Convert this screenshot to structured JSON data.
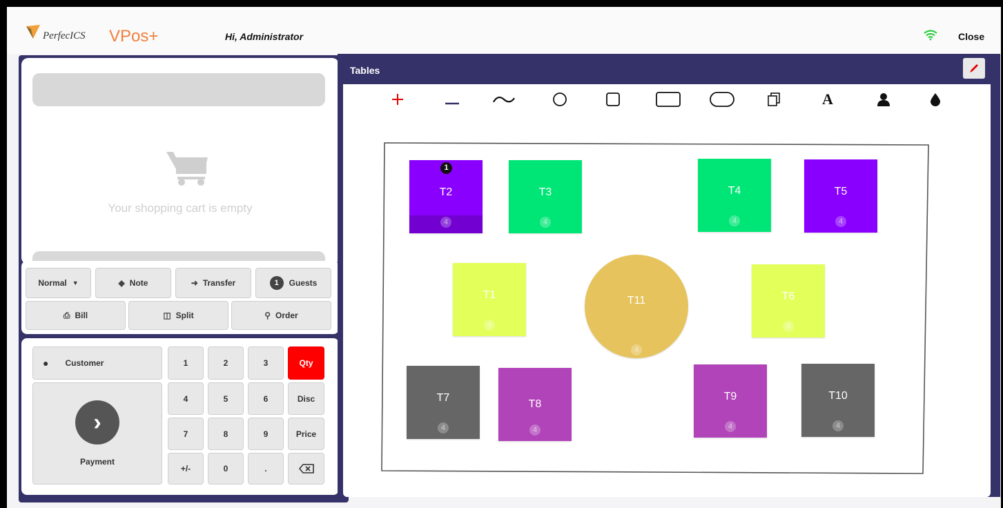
{
  "header": {
    "brand_perfecics": "PerfecICS",
    "brand_vpos": "VPos+",
    "greeting": "Hi, Administrator",
    "close_label": "Close"
  },
  "cart": {
    "empty_text": "Your shopping cart is empty"
  },
  "actions": {
    "mode": "Normal",
    "note": "Note",
    "transfer": "Transfer",
    "guests_count": "1",
    "guests": "Guests",
    "bill": "Bill",
    "split": "Split",
    "order": "Order"
  },
  "keypad": {
    "customer": "Customer",
    "payment": "Payment",
    "keys": [
      "1",
      "2",
      "3",
      "Qty",
      "4",
      "5",
      "6",
      "Disc",
      "7",
      "8",
      "9",
      "Price",
      "+/-",
      "0",
      "."
    ]
  },
  "tables": {
    "title": "Tables",
    "tools": [
      "add-icon",
      "remove-icon",
      "freehand-icon",
      "circle-icon",
      "square-icon",
      "rectangle-icon",
      "rounded-rect-icon",
      "copy-icon",
      "text-icon",
      "person-icon",
      "color-drop-icon"
    ],
    "items": [
      {
        "name": "T2",
        "seats": "4",
        "color": "#8a00ff",
        "badge": "1"
      },
      {
        "name": "T3",
        "seats": "4",
        "color": "#00e676"
      },
      {
        "name": "T4",
        "seats": "4",
        "color": "#00e676"
      },
      {
        "name": "T5",
        "seats": "4",
        "color": "#8a00ff"
      },
      {
        "name": "T1",
        "seats": "4",
        "color": "#e2ff5a"
      },
      {
        "name": "T11",
        "seats": "4",
        "color": "#e6c35c"
      },
      {
        "name": "T6",
        "seats": "4",
        "color": "#e2ff5a"
      },
      {
        "name": "T7",
        "seats": "4",
        "color": "#666666"
      },
      {
        "name": "T8",
        "seats": "4",
        "color": "#b044b8"
      },
      {
        "name": "T9",
        "seats": "4",
        "color": "#b044b8"
      },
      {
        "name": "T10",
        "seats": "4",
        "color": "#666666"
      }
    ]
  }
}
